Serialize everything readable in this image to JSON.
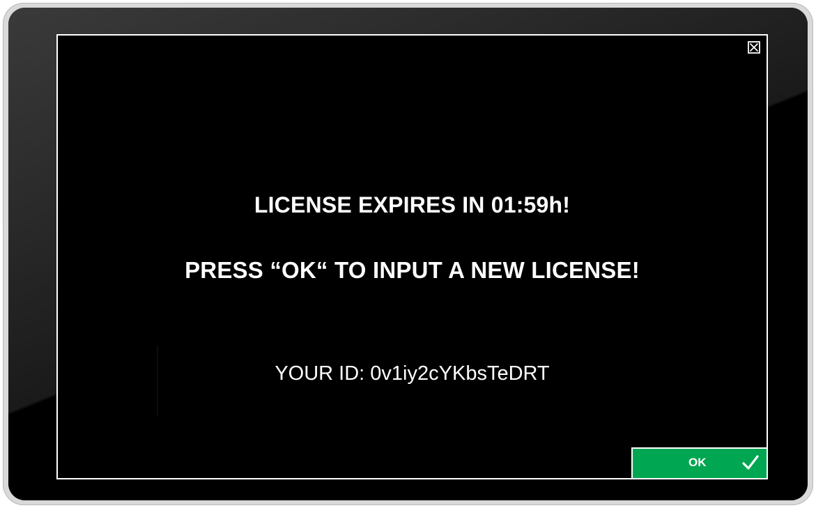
{
  "dialog": {
    "line1": "LICENSE EXPIRES IN 01:59h!",
    "line2": "PRESS “OK“ TO INPUT A NEW LICENSE!",
    "id_text": "YOUR ID: 0v1iy2cYKbsTeDRT"
  },
  "close": {
    "icon": "close-box-icon"
  },
  "ok_button": {
    "label": "OK",
    "icon": "checkmark-icon",
    "color": "#00a651"
  },
  "colors": {
    "screen_background": "#000000",
    "text": "#ffffff",
    "frame": "#d9d9d9"
  }
}
